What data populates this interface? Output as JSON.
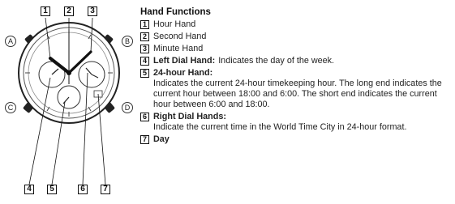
{
  "diagram": {
    "callouts_top": [
      "1",
      "2",
      "3"
    ],
    "callouts_bottom": [
      "4",
      "5",
      "6",
      "7"
    ],
    "buttons": [
      "A",
      "B",
      "C",
      "D"
    ]
  },
  "section": {
    "title": "Hand Functions",
    "items": [
      {
        "num": "1",
        "label": "Hour Hand"
      },
      {
        "num": "2",
        "label": "Second Hand"
      },
      {
        "num": "3",
        "label": "Minute Hand"
      },
      {
        "num": "4",
        "label": "Left Dial Hand:",
        "desc": "Indicates the day of the week."
      },
      {
        "num": "5",
        "label": "24-hour Hand:",
        "desc": "Indicates the current 24-hour timekeeping hour. The long end indicates the current hour between 18:00 and 6:00. The short end indicates the current hour between 6:00 and 18:00."
      },
      {
        "num": "6",
        "label": "Right Dial Hands:",
        "desc": "Indicate the current time in the World Time City in 24-hour format."
      },
      {
        "num": "7",
        "label": "Day"
      }
    ]
  }
}
